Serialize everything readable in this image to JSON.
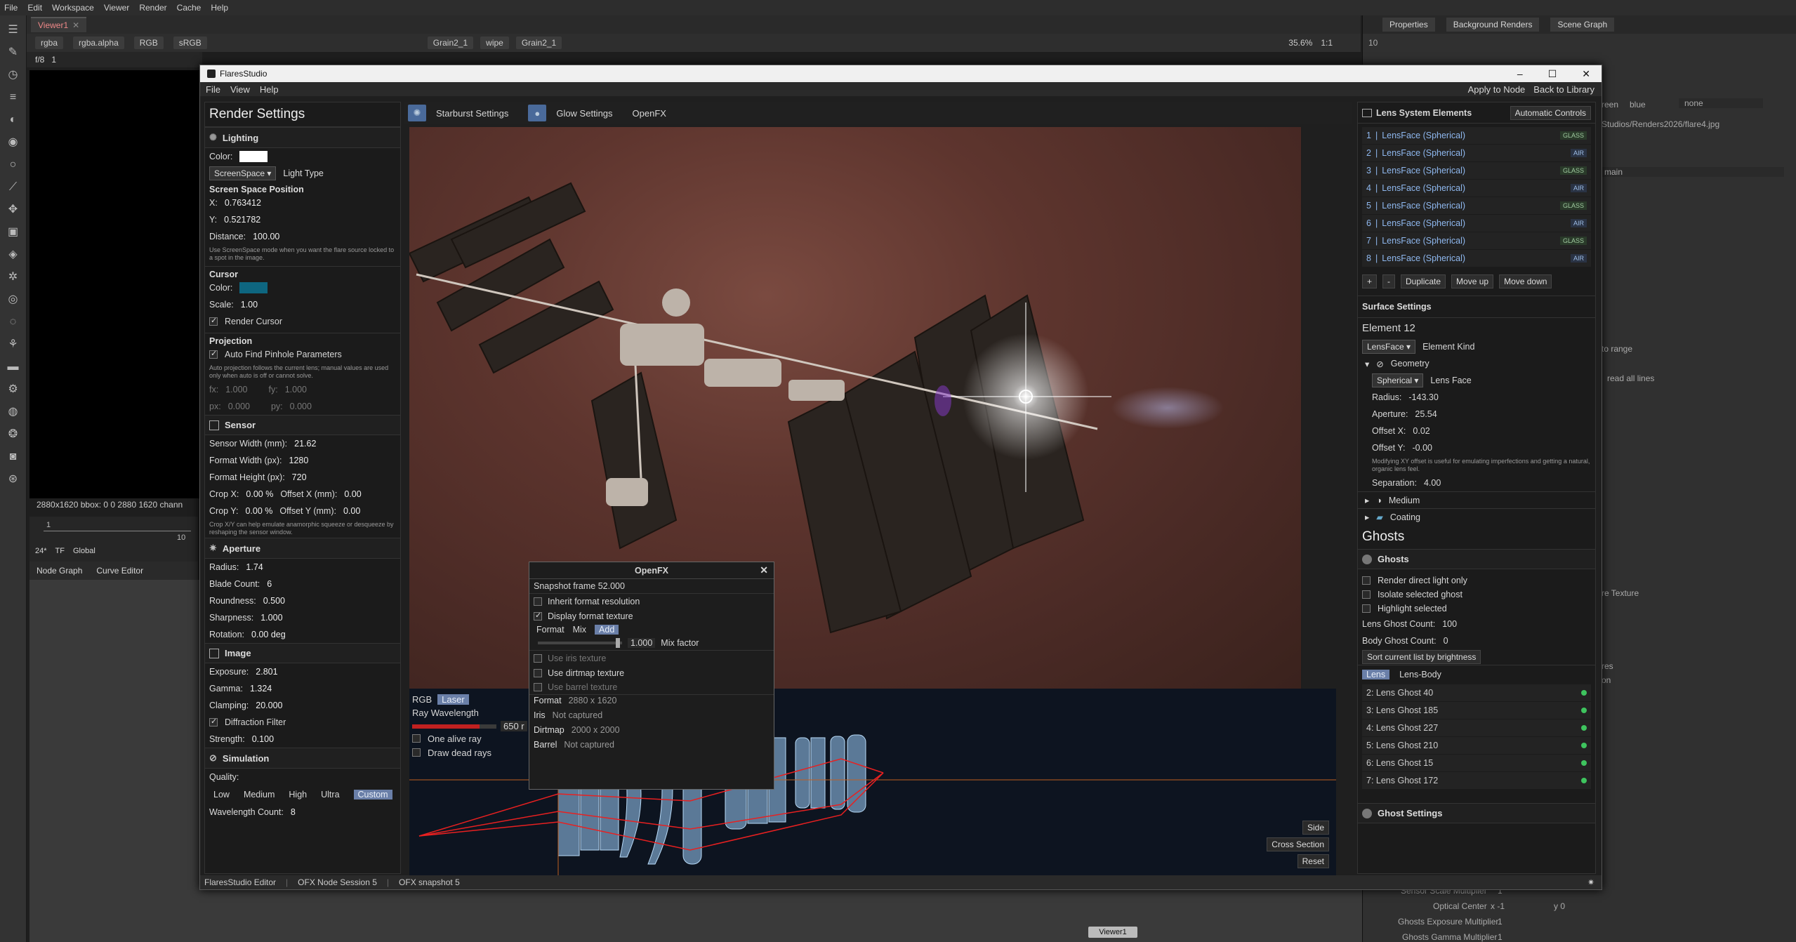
{
  "host": {
    "menu": [
      "File",
      "Edit",
      "Workspace",
      "Viewer",
      "Render",
      "Cache",
      "Help"
    ],
    "viewer_tab": "Viewer1",
    "viewer_controls": {
      "channels": "rgba",
      "alpha": "rgba.alpha",
      "rgb": "RGB",
      "colorspace": "sRGB",
      "input_a": "Grain2_1",
      "wipe": "wipe",
      "input_b": "Grain2_1",
      "zoom": "35.6%",
      "ratio": "1:1"
    },
    "frame": {
      "label": "f/8",
      "value": "1"
    },
    "bbox": "2880x1620  bbox: 0 0 2880 1620 chann",
    "timeline": {
      "start": "1",
      "end": "10",
      "fps": "24*",
      "tf": "TF",
      "global": "Global"
    },
    "bottom_tabs": [
      "Node Graph",
      "Curve Editor"
    ],
    "viewer_node": "Viewer1",
    "right_tabs": [
      "Properties",
      "Background Renders",
      "Scene Graph"
    ],
    "right_props": {
      "path": "Studios/Renders2026/flare4.jpg",
      "green": "reen",
      "blue": "blue",
      "none": "none",
      "main": "main",
      "to_range": "to range",
      "read_all": "read all lines",
      "texture": "re Texture",
      "res": "res",
      "on": "on",
      "sensor_scale": "Sensor Scale Multiplier",
      "sensor_scale_val": "1",
      "optical_center": "Optical Center",
      "oc_x": "x -1",
      "oc_y": "y 0",
      "ghost_exposure": "Ghosts Exposure Multiplier",
      "ghost_exposure_val": "1",
      "ghost_gamma": "Ghosts Gamma Multiplier",
      "ghost_gamma_val": "1",
      "ten": "10"
    }
  },
  "window": {
    "title": "FlaresStudio",
    "menu": [
      "File",
      "View",
      "Help"
    ],
    "menu_right": [
      "Apply to Node",
      "Back to Library"
    ],
    "status": [
      "FlaresStudio Editor",
      "OFX Node Session 5",
      "OFX snapshot 5"
    ]
  },
  "render_settings": {
    "title": "Render Settings",
    "lighting": {
      "head": "Lighting",
      "color_label": "Color:",
      "color": "#ffffff",
      "light_type_value": "ScreenSpace",
      "light_type_label": "Light Type",
      "ssp_title": "Screen Space Position",
      "x_label": "X:",
      "x": "0.763412",
      "y_label": "Y:",
      "y": "0.521782",
      "distance_label": "Distance:",
      "distance": "100.00",
      "hint": "Use ScreenSpace mode when you want the flare source locked to a spot in the image."
    },
    "cursor": {
      "title": "Cursor",
      "color_label": "Color:",
      "color": "#0e6680",
      "scale_label": "Scale:",
      "scale": "1.00",
      "render_cursor": "Render Cursor"
    },
    "projection": {
      "title": "Projection",
      "auto_find": "Auto Find Pinhole Parameters",
      "hint": "Auto projection follows the current lens; manual values are used only when auto is off or cannot solve.",
      "fx_label": "fx:",
      "fx": "1.000",
      "fy_label": "fy:",
      "fy": "1.000",
      "px_label": "px:",
      "px": "0.000",
      "py_label": "py:",
      "py": "0.000"
    },
    "sensor": {
      "head": "Sensor",
      "width_label": "Sensor Width (mm):",
      "width": "21.62",
      "fw_label": "Format Width (px):",
      "fw": "1280",
      "fh_label": "Format Height (px):",
      "fh": "720",
      "cropx_label": "Crop X:",
      "cropx": "0.00 %",
      "offx_label": "Offset X (mm):",
      "offx": "0.00",
      "cropy_label": "Crop Y:",
      "cropy": "0.00 %",
      "offy_label": "Offset Y (mm):",
      "offy": "0.00",
      "hint": "Crop X/Y can help emulate anamorphic squeeze or desqueeze by reshaping the sensor window."
    },
    "aperture": {
      "head": "Aperture",
      "radius_label": "Radius:",
      "radius": "1.74",
      "blade_label": "Blade Count:",
      "blade": "6",
      "round_label": "Roundness:",
      "round": "0.500",
      "sharp_label": "Sharpness:",
      "sharp": "1.000",
      "rot_label": "Rotation:",
      "rot": "0.00 deg"
    },
    "image": {
      "head": "Image",
      "exposure_label": "Exposure:",
      "exposure": "2.801",
      "gamma_label": "Gamma:",
      "gamma": "1.324",
      "clamp_label": "Clamping:",
      "clamp": "20.000",
      "diffraction": "Diffraction Filter",
      "strength_label": "Strength:",
      "strength": "0.100"
    },
    "simulation": {
      "head": "Simulation",
      "quality_label": "Quality:",
      "qualities": [
        "Low",
        "Medium",
        "High",
        "Ultra",
        "Custom"
      ],
      "active_quality": "Custom",
      "wavelength_label": "Wavelength Count:",
      "wavelength": "8"
    }
  },
  "center_tabs": [
    "Starburst Settings",
    "Glow Settings",
    "OpenFX"
  ],
  "ray_panel": {
    "modes": [
      "RGB",
      "Laser"
    ],
    "active_mode": "Laser",
    "wavelength_label": "Ray Wavelength",
    "wavelength_value": "650 r",
    "wavelength_fraction": 0.8,
    "one_alive": "One alive ray",
    "draw_dead": "Draw dead rays",
    "buttons": [
      "Side",
      "Cross Section",
      "Reset"
    ]
  },
  "openfx": {
    "title": "OpenFX",
    "snapshot": "Snapshot frame 52.000",
    "inherit": "Inherit format resolution",
    "display_tex": "Display format texture",
    "modes": [
      "Format",
      "Mix",
      "Add"
    ],
    "active_mode": "Add",
    "mix_value": "1.000",
    "mix_label": "Mix factor",
    "mix_fraction": 0.95,
    "iris_tex": "Use iris texture",
    "dirt_tex": "Use dirtmap texture",
    "barrel_tex": "Use barrel texture",
    "info": [
      {
        "k": "Format",
        "v": "2880 x 1620"
      },
      {
        "k": "Iris",
        "v": "Not captured"
      },
      {
        "k": "Dirtmap",
        "v": "2000 x 2000"
      },
      {
        "k": "Barrel",
        "v": "Not captured"
      }
    ]
  },
  "lens_panel": {
    "title": "Lens System Elements",
    "auto_btn": "Automatic Controls",
    "elements": [
      {
        "n": "1",
        "name": "LensFace (Spherical)",
        "tag": "GLASS"
      },
      {
        "n": "2",
        "name": "LensFace (Spherical)",
        "tag": "AIR"
      },
      {
        "n": "3",
        "name": "LensFace (Spherical)",
        "tag": "GLASS"
      },
      {
        "n": "4",
        "name": "LensFace (Spherical)",
        "tag": "AIR"
      },
      {
        "n": "5",
        "name": "LensFace (Spherical)",
        "tag": "GLASS"
      },
      {
        "n": "6",
        "name": "LensFace (Spherical)",
        "tag": "AIR"
      },
      {
        "n": "7",
        "name": "LensFace (Spherical)",
        "tag": "GLASS"
      },
      {
        "n": "8",
        "name": "LensFace (Spherical)",
        "tag": "AIR"
      }
    ],
    "element_buttons": [
      "+",
      "-",
      "Duplicate",
      "Move up",
      "Move down"
    ],
    "surface": {
      "head": "Surface Settings",
      "element": "Element 12",
      "kind_value": "LensFace",
      "kind_label": "Element Kind",
      "geometry": "Geometry",
      "shape_value": "Spherical",
      "shape_label": "Lens Face",
      "radius_label": "Radius:",
      "radius": "-143.30",
      "aperture_label": "Aperture:",
      "aperture": "25.54",
      "offx_label": "Offset X:",
      "offx": "0.02",
      "offy_label": "Offset Y:",
      "offy": "-0.00",
      "hint": "Modifying XY offset is useful for emulating imperfections and getting a natural, organic lens feel.",
      "sep_label": "Separation:",
      "sep": "4.00",
      "medium": "Medium",
      "coating": "Coating"
    },
    "ghosts": {
      "title": "Ghosts",
      "head": "Ghosts",
      "render_direct": "Render direct light only",
      "isolate": "Isolate selected ghost",
      "highlight": "Highlight selected",
      "lens_count_label": "Lens Ghost Count:",
      "lens_count": "100",
      "body_count_label": "Body Ghost Count:",
      "body_count": "0",
      "sort_btn": "Sort current list by brightness",
      "tabs": [
        "Lens",
        "Lens-Body"
      ],
      "active_tab": "Lens",
      "list": [
        "2: Lens Ghost 40",
        "3: Lens Ghost 185",
        "4: Lens Ghost 227",
        "5: Lens Ghost 210",
        "6: Lens Ghost 15",
        "7: Lens Ghost 172"
      ],
      "settings": "Ghost Settings"
    }
  }
}
